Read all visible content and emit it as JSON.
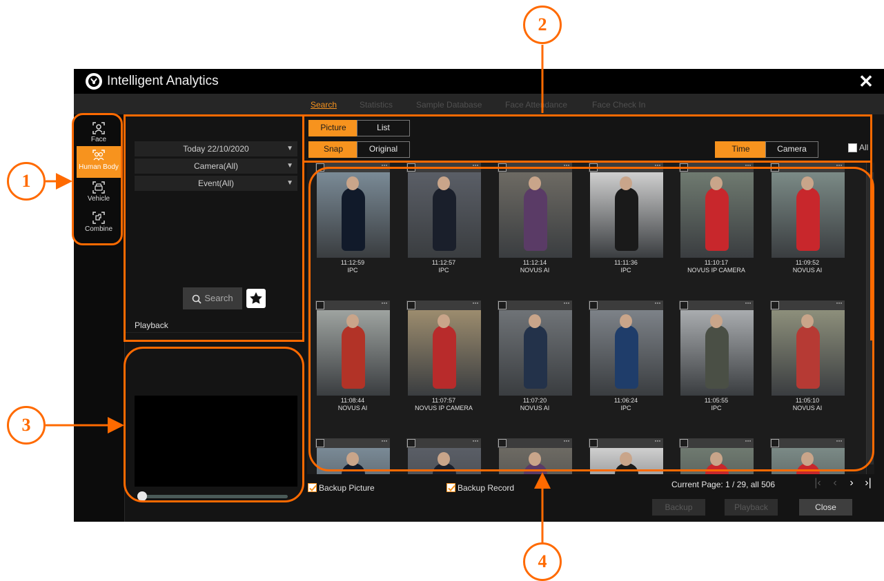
{
  "app": {
    "title": "Intelligent Analytics",
    "close_icon": "close-icon",
    "accent_color": "#f7931e"
  },
  "tabs": [
    {
      "label": "Search",
      "active": true
    },
    {
      "label": "Statistics"
    },
    {
      "label": "Sample Database"
    },
    {
      "label": "Face Attendance"
    },
    {
      "label": "Face Check In"
    }
  ],
  "modes": [
    {
      "label": "Face",
      "icon": "face-icon"
    },
    {
      "label": "Human Body",
      "icon": "human-body-icon",
      "active": true
    },
    {
      "label": "Vehicle",
      "icon": "vehicle-icon"
    },
    {
      "label": "Combine",
      "icon": "combine-icon"
    }
  ],
  "filters": {
    "date": "Today 22/10/2020",
    "camera": "Camera(All)",
    "event": "Event(All)",
    "search_label": "Search",
    "playback_label": "Playback"
  },
  "view": {
    "picture": "Picture",
    "list": "List",
    "snap": "Snap",
    "original": "Original",
    "sort_time": "Time",
    "sort_camera": "Camera",
    "select_all": "All"
  },
  "results": [
    {
      "time": "11:12:59",
      "camera": "IPC"
    },
    {
      "time": "11:12:57",
      "camera": "IPC"
    },
    {
      "time": "11:12:14",
      "camera": "NOVUS AI"
    },
    {
      "time": "11:11:36",
      "camera": "IPC"
    },
    {
      "time": "11:10:17",
      "camera": "NOVUS IP CAMERA"
    },
    {
      "time": "11:09:52",
      "camera": "NOVUS AI"
    },
    {
      "time": "11:08:44",
      "camera": "NOVUS AI"
    },
    {
      "time": "11:07:57",
      "camera": "NOVUS IP CAMERA"
    },
    {
      "time": "11:07:20",
      "camera": "NOVUS AI"
    },
    {
      "time": "11:06:24",
      "camera": "IPC"
    },
    {
      "time": "11:05:55",
      "camera": "IPC"
    },
    {
      "time": "11:05:10",
      "camera": "NOVUS AI"
    }
  ],
  "footer": {
    "backup_picture": "Backup Picture",
    "backup_record": "Backup Record",
    "page_info": "Current Page: 1 / 29, all 506",
    "backup": "Backup",
    "playback": "Playback",
    "close": "Close"
  },
  "callouts": {
    "one": "1",
    "two": "2",
    "three": "3",
    "four": "4",
    "color": "#ff6a00"
  }
}
